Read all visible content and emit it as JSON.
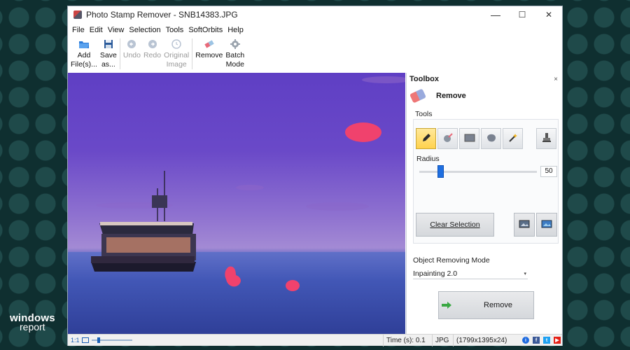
{
  "window": {
    "title": "Photo Stamp Remover - SNB14383.JPG",
    "controls": {
      "minimize": "—",
      "maximize": "☐",
      "close": "✕"
    }
  },
  "menu": [
    "File",
    "Edit",
    "View",
    "Selection",
    "Tools",
    "SoftOrbits",
    "Help"
  ],
  "toolbar": {
    "add_files": "Add\nFile(s)...",
    "save_as": "Save\nas...",
    "undo": "Undo",
    "redo": "Redo",
    "original_image": "Original\nImage",
    "remove": "Remove",
    "batch_mode": "Batch\nMode"
  },
  "toolbox": {
    "title": "Toolbox",
    "close": "×",
    "section_title": "Remove",
    "tools_label": "Tools",
    "tools": [
      "pencil-icon",
      "brush-icon",
      "rectangle-select-icon",
      "lasso-icon",
      "magic-wand-icon",
      "stamp-icon"
    ],
    "active_tool": "pencil-icon",
    "radius_label": "Radius",
    "radius_value": "50",
    "clear_selection": "Clear Selection",
    "mode_label": "Object Removing Mode",
    "mode_value": "Inpainting 2.0",
    "remove_button": "Remove"
  },
  "status": {
    "zoom": "1:1",
    "time": "Time (s): 0.1",
    "format": "JPG",
    "dimensions": "(1799x1395x24)"
  },
  "colors": {
    "selection": "#f0426d",
    "sky_top": "#5f3fc4",
    "sea": "#2f3f98",
    "accent": "#1f6fe0"
  },
  "brand": {
    "line1": "windows",
    "line2": "report"
  }
}
